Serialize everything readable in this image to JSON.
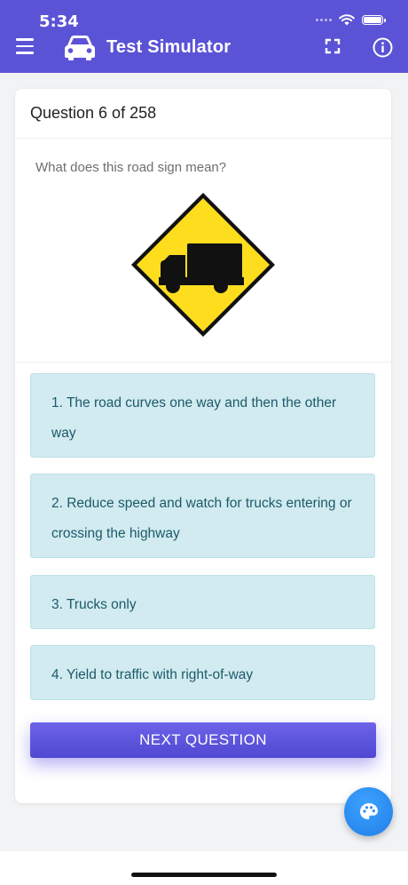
{
  "status_bar": {
    "time": "5:34"
  },
  "app_bar": {
    "title": "Test Simulator",
    "menu_icon": "hamburger-menu-icon",
    "logo_icon": "car-icon",
    "fullscreen_icon": "fullscreen-icon",
    "info_icon": "info-icon"
  },
  "quiz": {
    "header": "Question 6 of 258",
    "question": "What does this road sign mean?",
    "sign_icon": "truck-crossing-warning-sign",
    "options": [
      {
        "label": "1. The road curves one way and then the other way"
      },
      {
        "label": "2. Reduce speed and watch for trucks entering or crossing the highway"
      },
      {
        "label": "3. Trucks only"
      },
      {
        "label": "4. Yield to traffic with right-of-way"
      }
    ],
    "next_label": "NEXT QUESTION"
  },
  "fab": {
    "icon": "palette-icon"
  },
  "colors": {
    "primary": "#5b53d6",
    "option_bg": "#d1ebf0",
    "option_text": "#1c5a68",
    "fab": "#2b8df5",
    "sign_yellow": "#fedd1f"
  }
}
